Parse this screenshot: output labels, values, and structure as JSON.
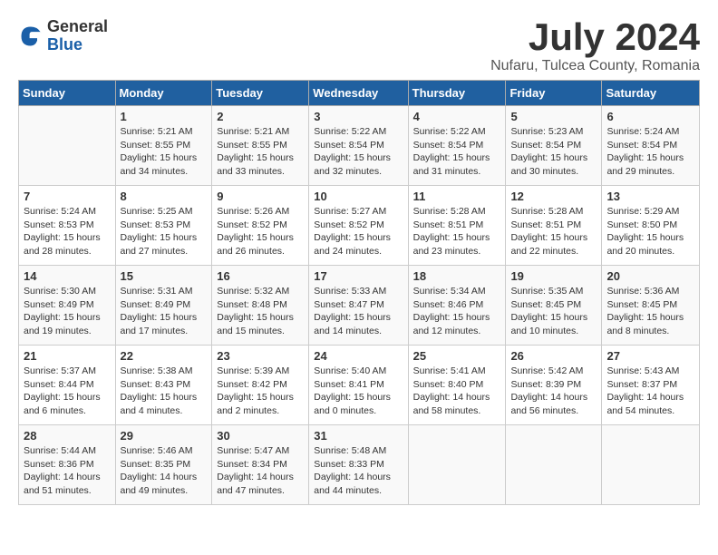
{
  "logo": {
    "general": "General",
    "blue": "Blue"
  },
  "header": {
    "title": "July 2024",
    "subtitle": "Nufaru, Tulcea County, Romania"
  },
  "weekdays": [
    "Sunday",
    "Monday",
    "Tuesday",
    "Wednesday",
    "Thursday",
    "Friday",
    "Saturday"
  ],
  "weeks": [
    [
      {
        "day": "",
        "sunrise": "",
        "sunset": "",
        "daylight": ""
      },
      {
        "day": "1",
        "sunrise": "Sunrise: 5:21 AM",
        "sunset": "Sunset: 8:55 PM",
        "daylight": "Daylight: 15 hours and 34 minutes."
      },
      {
        "day": "2",
        "sunrise": "Sunrise: 5:21 AM",
        "sunset": "Sunset: 8:55 PM",
        "daylight": "Daylight: 15 hours and 33 minutes."
      },
      {
        "day": "3",
        "sunrise": "Sunrise: 5:22 AM",
        "sunset": "Sunset: 8:54 PM",
        "daylight": "Daylight: 15 hours and 32 minutes."
      },
      {
        "day": "4",
        "sunrise": "Sunrise: 5:22 AM",
        "sunset": "Sunset: 8:54 PM",
        "daylight": "Daylight: 15 hours and 31 minutes."
      },
      {
        "day": "5",
        "sunrise": "Sunrise: 5:23 AM",
        "sunset": "Sunset: 8:54 PM",
        "daylight": "Daylight: 15 hours and 30 minutes."
      },
      {
        "day": "6",
        "sunrise": "Sunrise: 5:24 AM",
        "sunset": "Sunset: 8:54 PM",
        "daylight": "Daylight: 15 hours and 29 minutes."
      }
    ],
    [
      {
        "day": "7",
        "sunrise": "Sunrise: 5:24 AM",
        "sunset": "Sunset: 8:53 PM",
        "daylight": "Daylight: 15 hours and 28 minutes."
      },
      {
        "day": "8",
        "sunrise": "Sunrise: 5:25 AM",
        "sunset": "Sunset: 8:53 PM",
        "daylight": "Daylight: 15 hours and 27 minutes."
      },
      {
        "day": "9",
        "sunrise": "Sunrise: 5:26 AM",
        "sunset": "Sunset: 8:52 PM",
        "daylight": "Daylight: 15 hours and 26 minutes."
      },
      {
        "day": "10",
        "sunrise": "Sunrise: 5:27 AM",
        "sunset": "Sunset: 8:52 PM",
        "daylight": "Daylight: 15 hours and 24 minutes."
      },
      {
        "day": "11",
        "sunrise": "Sunrise: 5:28 AM",
        "sunset": "Sunset: 8:51 PM",
        "daylight": "Daylight: 15 hours and 23 minutes."
      },
      {
        "day": "12",
        "sunrise": "Sunrise: 5:28 AM",
        "sunset": "Sunset: 8:51 PM",
        "daylight": "Daylight: 15 hours and 22 minutes."
      },
      {
        "day": "13",
        "sunrise": "Sunrise: 5:29 AM",
        "sunset": "Sunset: 8:50 PM",
        "daylight": "Daylight: 15 hours and 20 minutes."
      }
    ],
    [
      {
        "day": "14",
        "sunrise": "Sunrise: 5:30 AM",
        "sunset": "Sunset: 8:49 PM",
        "daylight": "Daylight: 15 hours and 19 minutes."
      },
      {
        "day": "15",
        "sunrise": "Sunrise: 5:31 AM",
        "sunset": "Sunset: 8:49 PM",
        "daylight": "Daylight: 15 hours and 17 minutes."
      },
      {
        "day": "16",
        "sunrise": "Sunrise: 5:32 AM",
        "sunset": "Sunset: 8:48 PM",
        "daylight": "Daylight: 15 hours and 15 minutes."
      },
      {
        "day": "17",
        "sunrise": "Sunrise: 5:33 AM",
        "sunset": "Sunset: 8:47 PM",
        "daylight": "Daylight: 15 hours and 14 minutes."
      },
      {
        "day": "18",
        "sunrise": "Sunrise: 5:34 AM",
        "sunset": "Sunset: 8:46 PM",
        "daylight": "Daylight: 15 hours and 12 minutes."
      },
      {
        "day": "19",
        "sunrise": "Sunrise: 5:35 AM",
        "sunset": "Sunset: 8:45 PM",
        "daylight": "Daylight: 15 hours and 10 minutes."
      },
      {
        "day": "20",
        "sunrise": "Sunrise: 5:36 AM",
        "sunset": "Sunset: 8:45 PM",
        "daylight": "Daylight: 15 hours and 8 minutes."
      }
    ],
    [
      {
        "day": "21",
        "sunrise": "Sunrise: 5:37 AM",
        "sunset": "Sunset: 8:44 PM",
        "daylight": "Daylight: 15 hours and 6 minutes."
      },
      {
        "day": "22",
        "sunrise": "Sunrise: 5:38 AM",
        "sunset": "Sunset: 8:43 PM",
        "daylight": "Daylight: 15 hours and 4 minutes."
      },
      {
        "day": "23",
        "sunrise": "Sunrise: 5:39 AM",
        "sunset": "Sunset: 8:42 PM",
        "daylight": "Daylight: 15 hours and 2 minutes."
      },
      {
        "day": "24",
        "sunrise": "Sunrise: 5:40 AM",
        "sunset": "Sunset: 8:41 PM",
        "daylight": "Daylight: 15 hours and 0 minutes."
      },
      {
        "day": "25",
        "sunrise": "Sunrise: 5:41 AM",
        "sunset": "Sunset: 8:40 PM",
        "daylight": "Daylight: 14 hours and 58 minutes."
      },
      {
        "day": "26",
        "sunrise": "Sunrise: 5:42 AM",
        "sunset": "Sunset: 8:39 PM",
        "daylight": "Daylight: 14 hours and 56 minutes."
      },
      {
        "day": "27",
        "sunrise": "Sunrise: 5:43 AM",
        "sunset": "Sunset: 8:37 PM",
        "daylight": "Daylight: 14 hours and 54 minutes."
      }
    ],
    [
      {
        "day": "28",
        "sunrise": "Sunrise: 5:44 AM",
        "sunset": "Sunset: 8:36 PM",
        "daylight": "Daylight: 14 hours and 51 minutes."
      },
      {
        "day": "29",
        "sunrise": "Sunrise: 5:46 AM",
        "sunset": "Sunset: 8:35 PM",
        "daylight": "Daylight: 14 hours and 49 minutes."
      },
      {
        "day": "30",
        "sunrise": "Sunrise: 5:47 AM",
        "sunset": "Sunset: 8:34 PM",
        "daylight": "Daylight: 14 hours and 47 minutes."
      },
      {
        "day": "31",
        "sunrise": "Sunrise: 5:48 AM",
        "sunset": "Sunset: 8:33 PM",
        "daylight": "Daylight: 14 hours and 44 minutes."
      },
      {
        "day": "",
        "sunrise": "",
        "sunset": "",
        "daylight": ""
      },
      {
        "day": "",
        "sunrise": "",
        "sunset": "",
        "daylight": ""
      },
      {
        "day": "",
        "sunrise": "",
        "sunset": "",
        "daylight": ""
      }
    ]
  ]
}
